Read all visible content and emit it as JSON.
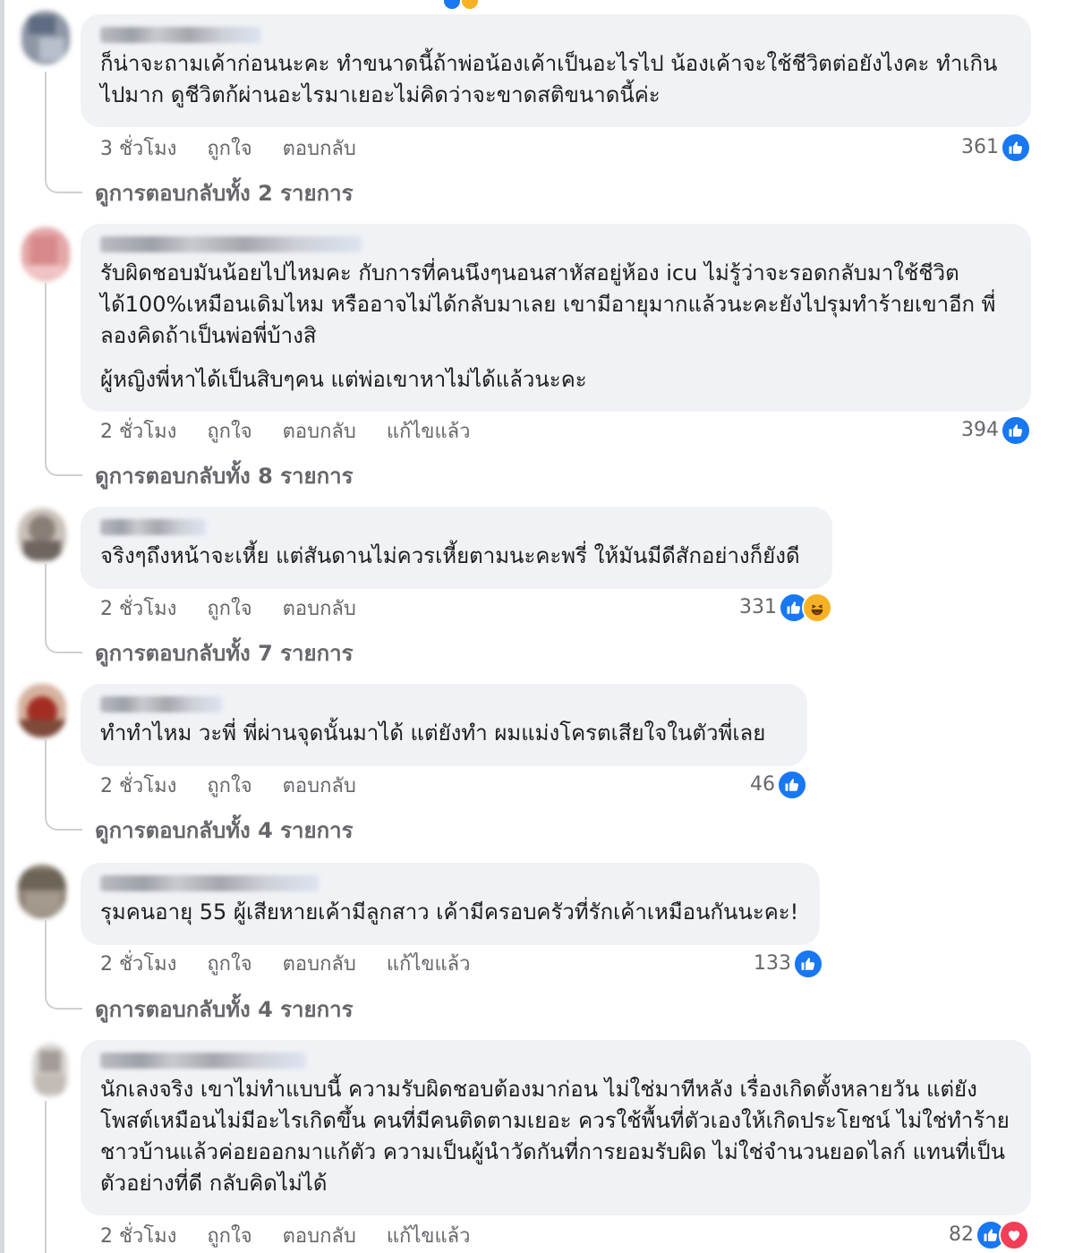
{
  "ui": {
    "like_icon": "thumbs-up-icon",
    "haha_icon": "laughing-face-icon",
    "love_icon": "heart-icon",
    "like_color": "#1877f2",
    "haha_color": "#f7b125",
    "love_color": "#f33e58",
    "bubble_color": "#f0f2f5"
  },
  "comments": [
    {
      "paragraphs": [
        "ก็น่าจะถามเค้าก่อนนะคะ ทำขนาดนี้ถ้าพ่อน้องเค้าเป็นอะไรไป น้องเค้าจะใช้ชีวิตต่อยังไงคะ ทำเกินไปมาก ดูชีวิตก้ผ่านอะไรมาเยอะไม่คิดว่าจะขาดสติขนาดนี้ค่ะ"
      ],
      "time": "3 ชั่วโมง",
      "like": "ถูกใจ",
      "reply": "ตอบกลับ",
      "edited": "",
      "reaction_count": "361",
      "reactions": [
        "like"
      ],
      "replies": "ดูการตอบกลับทั้ง 2 รายการ"
    },
    {
      "paragraphs": [
        "รับผิดชอบมันน้อยไปไหมคะ กับการที่คนนึงๆนอนสาหัสอยู่ห้อง icu ไม่รู้ว่าจะรอดกลับมาใช้ชีวิตได้100%เหมือนเดิมไหม หรืออาจไม่ได้กลับมาเลย เขามีอายุมากแล้วนะคะยังไปรุมทำร้ายเขาอีก พี่ลองคิดถ้าเป็นพ่อพี่บ้างสิ",
        "ผู้หญิงพี่หาได้เป็นสิบๆคน แต่พ่อเขาหาไม่ได้แล้วนะคะ"
      ],
      "time": "2 ชั่วโมง",
      "like": "ถูกใจ",
      "reply": "ตอบกลับ",
      "edited": "แก้ไขแล้ว",
      "reaction_count": "394",
      "reactions": [
        "like"
      ],
      "replies": "ดูการตอบกลับทั้ง 8 รายการ"
    },
    {
      "paragraphs": [
        "จริงๆถึงหน้าจะเหี้ย แต่สันดานไม่ควรเหี้ยตามนะคะพรี่ ให้มันมีดีสักอย่างก็ยังดี"
      ],
      "time": "2 ชั่วโมง",
      "like": "ถูกใจ",
      "reply": "ตอบกลับ",
      "edited": "",
      "reaction_count": "331",
      "reactions": [
        "like",
        "haha"
      ],
      "replies": "ดูการตอบกลับทั้ง 7 รายการ"
    },
    {
      "paragraphs": [
        "ทำทำไหม วะพี่ พี่ผ่านจุดนั้นมาได้ แต่ยังทำ ผมแม่งโครตเสียใจในตัวพี่เลย"
      ],
      "time": "2 ชั่วโมง",
      "like": "ถูกใจ",
      "reply": "ตอบกลับ",
      "edited": "",
      "reaction_count": "46",
      "reactions": [
        "like"
      ],
      "replies": "ดูการตอบกลับทั้ง 4 รายการ"
    },
    {
      "paragraphs": [
        "รุมคนอายุ 55 ผู้เสียหายเค้ามีลูกสาว เค้ามีครอบครัวที่รักเค้าเหมือนกันนะคะ!"
      ],
      "time": "2 ชั่วโมง",
      "like": "ถูกใจ",
      "reply": "ตอบกลับ",
      "edited": "แก้ไขแล้ว",
      "reaction_count": "133",
      "reactions": [
        "like"
      ],
      "replies": "ดูการตอบกลับทั้ง 4 รายการ"
    },
    {
      "paragraphs": [
        "นักเลงจริง เขาไม่ทำแบบนี้ ความรับผิดชอบต้องมาก่อน ไม่ใช่มาทีหลัง เรื่องเกิดตั้งหลายวัน แต่ยังโพสต์เหมือนไม่มีอะไรเกิดขึ้น คนที่มีคนติดตามเยอะ ควรใช้พื้นที่ตัวเองให้เกิดประโยชน์ ไม่ใช่ทำร้ายชาวบ้านแล้วค่อยออกมาแก้ตัว ความเป็นผู้นำวัดกันที่การยอมรับผิด ไม่ใช่จำนวนยอดไลก์ แทนที่เป็นตัวอย่างที่ดี กลับคิดไม่ได้"
      ],
      "time": "2 ชั่วโมง",
      "like": "ถูกใจ",
      "reply": "ตอบกลับ",
      "edited": "แก้ไขแล้ว",
      "reaction_count": "82",
      "reactions": [
        "like",
        "love"
      ],
      "replies": ""
    }
  ]
}
